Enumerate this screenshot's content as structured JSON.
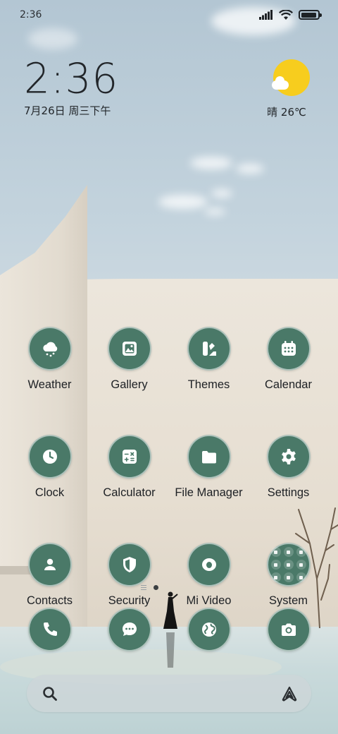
{
  "status_bar": {
    "time": "2:36",
    "icons": [
      "signal-icon",
      "wifi-icon",
      "battery-icon"
    ],
    "battery_level": 0.95
  },
  "clock_widget": {
    "time": "2:36",
    "date": "7月26日 周三下午"
  },
  "weather_widget": {
    "icon": "sunny-cloud-icon",
    "text": "晴 26℃"
  },
  "apps": [
    {
      "label": "Weather",
      "icon": "weather-icon"
    },
    {
      "label": "Gallery",
      "icon": "gallery-icon"
    },
    {
      "label": "Themes",
      "icon": "themes-icon"
    },
    {
      "label": "Calendar",
      "icon": "calendar-icon"
    },
    {
      "label": "Clock",
      "icon": "clock-icon"
    },
    {
      "label": "Calculator",
      "icon": "calculator-icon"
    },
    {
      "label": "File Manager",
      "icon": "folder-icon"
    },
    {
      "label": "Settings",
      "icon": "gear-icon"
    },
    {
      "label": "Contacts",
      "icon": "contacts-icon"
    },
    {
      "label": "Security",
      "icon": "shield-icon"
    },
    {
      "label": "Mi Video",
      "icon": "video-icon"
    },
    {
      "label": "System",
      "icon": "folder-grid-icon"
    }
  ],
  "page_indicator": {
    "pages": 1,
    "current": 1
  },
  "dock": [
    {
      "icon": "phone-icon"
    },
    {
      "icon": "messages-icon"
    },
    {
      "icon": "browser-icon"
    },
    {
      "icon": "camera-icon"
    }
  ],
  "search_bar": {
    "left_icon": "search-icon",
    "right_icon": "assistant-icon"
  },
  "colors": {
    "icon_background": "#4a7968",
    "sun": "#f7cd1e",
    "text_dark": "#1d2024"
  }
}
